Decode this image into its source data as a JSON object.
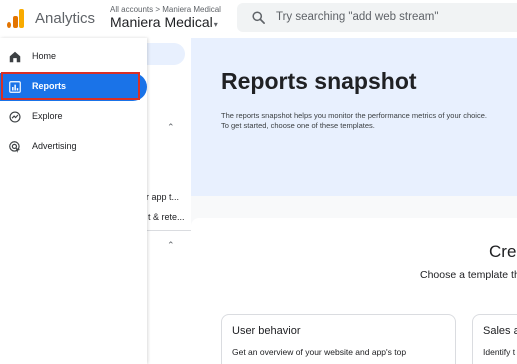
{
  "header": {
    "app_name": "Analytics",
    "breadcrumb": "All accounts > Maniera Medical",
    "account_name": "Maniera Medical",
    "account_caret": "▾",
    "search_placeholder": "Try searching \"add web stream\""
  },
  "nav": {
    "items": [
      {
        "label": "Home",
        "icon": "home-icon"
      },
      {
        "label": "Reports",
        "icon": "reports-icon",
        "active": true
      },
      {
        "label": "Explore",
        "icon": "explore-icon"
      },
      {
        "label": "Advertising",
        "icon": "advertising-icon"
      }
    ]
  },
  "subnav": {
    "chevron_1": "⌃",
    "item_1": "r app t...",
    "item_2": "t & rete...",
    "chevron_2": "⌃"
  },
  "main": {
    "title": "Reports snapshot",
    "desc_line1": "The reports snapshot helps you monitor the performance metrics of your choice.",
    "desc_line2": "To get started, choose one of these templates.",
    "create_heading": "Crea",
    "choose_text": "Choose a template th",
    "cards": [
      {
        "title": "User behavior",
        "text": "Get an overview of your website and app's top"
      },
      {
        "title": "Sales a",
        "text": "Identify t"
      }
    ]
  },
  "colors": {
    "accent": "#1a73e8",
    "highlight": "#d93025",
    "hero_bg": "#e8f0fe"
  }
}
